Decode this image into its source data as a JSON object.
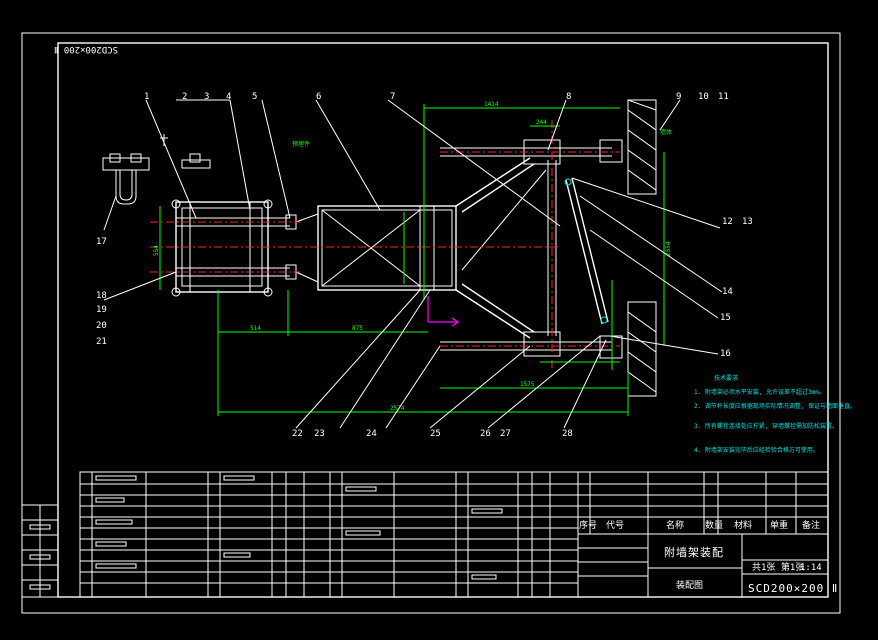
{
  "drawing": {
    "drawing_number": "SCD200×200 Ⅱ",
    "drawing_number_corner": "SCD200×200 Ⅱ",
    "title": "附墙架装配",
    "subtitle": "装配图",
    "scale_label": "1:14",
    "sheet_label": "共1张 第1张"
  },
  "callouts": [
    "1",
    "2",
    "3",
    "4",
    "5",
    "6",
    "7",
    "8",
    "9",
    "10",
    "11",
    "12",
    "13",
    "14",
    "15",
    "16",
    "17",
    "18",
    "19",
    "20",
    "21",
    "22",
    "23",
    "24",
    "25",
    "26",
    "27",
    "28"
  ],
  "dimensions": {
    "top_span": "1414",
    "top_small": "244",
    "bottom_right": "1575",
    "bottom_total": "2574",
    "left_mid": "514",
    "mid": "875",
    "right_vertical": "2554",
    "left_vertical": "554"
  },
  "notes": {
    "heading": "技术要求",
    "items": [
      "1. 附墙架必须水平安装, 允许误差不超过3mm。",
      "2. 调节杆长度应根据现场实际情况调整, 保证与墙面垂直。",
      "3. 所有螺栓连接处应拧紧, 穿墙螺栓需加防松装置。",
      "4. 附墙架安装完毕后应经检验合格方可使用。"
    ]
  },
  "labels": {
    "weld_tag": "预埋件",
    "wall_tag": "墙体"
  },
  "title_block": {
    "headers": [
      "序号",
      "代号",
      "名称",
      "数量",
      "材料",
      "单重",
      "备注"
    ]
  }
}
